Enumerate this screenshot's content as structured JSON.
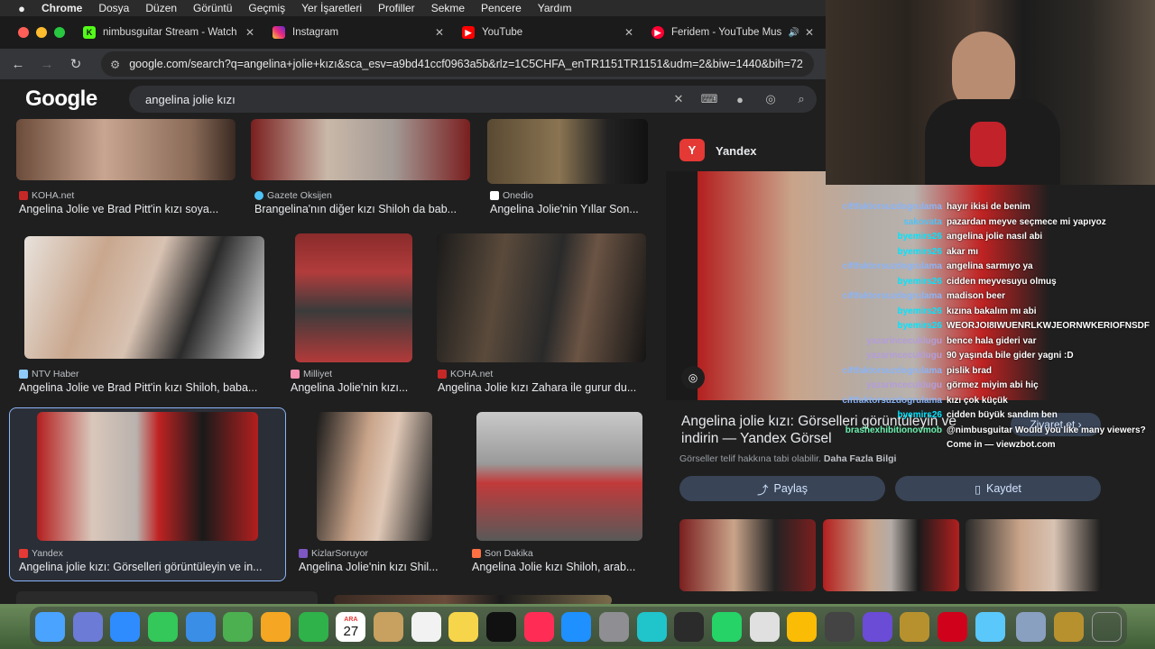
{
  "menubar": {
    "apple": "",
    "app": "Chrome",
    "items": [
      "Dosya",
      "Düzen",
      "Görüntü",
      "Geçmiş",
      "Yer İşaretleri",
      "Profiller",
      "Sekme",
      "Pencere",
      "Yardım"
    ]
  },
  "tabs": [
    {
      "title": "nimbusguitar Stream - Watch",
      "icon": "K",
      "color": "#53fc18"
    },
    {
      "title": "Instagram",
      "icon": "",
      "color": "#d6249f"
    },
    {
      "title": "YouTube",
      "icon": "▶",
      "color": "#ff0000"
    },
    {
      "title": "Feridem - YouTube Music",
      "icon": "▶",
      "color": "#ff0033"
    }
  ],
  "address": {
    "url": "google.com/search?q=angelina+jolie+kızı&sca_esv=a9bd41ccf0963a5b&rlz=1C5CHFA_enTR1151TR1151&udm=2&biw=1440&bih=72"
  },
  "google": {
    "logo": "Google",
    "query": "angelina jolie kızı"
  },
  "results": [
    {
      "source": "KOHA.net",
      "caption": "Angelina Jolie ve Brad Pitt'in kızı soya...",
      "src_color": "#c62828"
    },
    {
      "source": "Gazete Oksijen",
      "caption": "Brangelina'nın diğer kızı Shiloh da bab...",
      "src_color": "#4fc3f7"
    },
    {
      "source": "Onedio",
      "caption": "Angelina Jolie'nin Yıllar Son...",
      "src_color": "#ffffff"
    },
    {
      "source": "NTV Haber",
      "caption": "Angelina Jolie ve Brad Pitt'in kızı Shiloh, baba...",
      "src_color": "#90caf9"
    },
    {
      "source": "Milliyet",
      "caption": "Angelina Jolie'nin kızı...",
      "src_color": "#f48fb1"
    },
    {
      "source": "KOHA.net",
      "caption": "Angelina Jolie kızı Zahara ile gurur du...",
      "src_color": "#c62828"
    },
    {
      "source": "Yandex",
      "caption": "Angelina jolie kızı: Görselleri görüntüleyin ve in...",
      "src_color": "#e53935"
    },
    {
      "source": "KizlarSoruyor",
      "caption": "Angelina Jolie'nin kızı Shil...",
      "src_color": "#7e57c2"
    },
    {
      "source": "Son Dakika",
      "caption": "Angelina Jolie kızı Shiloh, arab...",
      "src_color": "#ff7043"
    }
  ],
  "panel": {
    "source": "Yandex",
    "title": "Angelina jolie kızı: Görselleri görüntüleyin ve indirin — Yandex Görsel",
    "note": "Görseller telif hakkına tabi olabilir.",
    "more": "Daha Fazla Bilgi",
    "visit": "Ziyaret et",
    "share": "Paylaş",
    "save": "Kaydet"
  },
  "chat": [
    {
      "user": "ciftfaktorsuzdogrulama",
      "text": "hayır ikisi de benim",
      "color": "#8ab4f8"
    },
    {
      "user": "sakovata",
      "text": "pazardan meyve seçmece mi yapıyoz",
      "color": "#4fc3f7"
    },
    {
      "user": "byemirs26",
      "text": "angelina jolie nasıl abi",
      "color": "#00e5ff"
    },
    {
      "user": "byemirs26",
      "text": "akar mı",
      "color": "#00e5ff"
    },
    {
      "user": "ciftfaktorsuzdogrulama",
      "text": "angelina sarmıyo ya",
      "color": "#8ab4f8"
    },
    {
      "user": "byemirs26",
      "text": "cidden meyvesuyu olmuş",
      "color": "#00e5ff"
    },
    {
      "user": "ciftfaktorsuzdogrulama",
      "text": "madison beer",
      "color": "#8ab4f8"
    },
    {
      "user": "byemirs26",
      "text": "kızına bakalım mı abi",
      "color": "#00e5ff"
    },
    {
      "user": "byemirs26",
      "text": "WEORJOI8IWUENRLKWJEORNWKERIOFNSDF",
      "color": "#00e5ff"
    },
    {
      "user": "yazarincecuklugu",
      "text": "bence hala gideri var",
      "color": "#b39ddb"
    },
    {
      "user": "yazarincecuklugu",
      "text": "90 yaşında bile gider yagni :D",
      "color": "#b39ddb"
    },
    {
      "user": "ciftfaktorsuzdogrulama",
      "text": "pislik brad",
      "color": "#8ab4f8"
    },
    {
      "user": "yazarincecuklugu",
      "text": "görmez miyim abi hiç",
      "color": "#b39ddb"
    },
    {
      "user": "ciftfaktorsuzdogrulama",
      "text": "kızı çok küçük",
      "color": "#8ab4f8"
    },
    {
      "user": "byemirs26",
      "text": "cidden büyük sandım ben",
      "color": "#00e5ff"
    },
    {
      "user": "brashexhibitionovmob",
      "text": "@nimbusguitar Would you like many viewers?",
      "color": "#69f0ae"
    },
    {
      "user": "",
      "text": "Come in — viewzbot.com",
      "color": "#ffffff"
    }
  ],
  "dock": {
    "calendar_month": "ARA",
    "calendar_day": "27",
    "apps": [
      "Finder",
      "Launchpad",
      "Safari",
      "Messages",
      "Mail",
      "Maps",
      "Photos",
      "FaceTime",
      "Calendar",
      "Notes",
      "Reminders",
      "Stickies",
      "Apple TV",
      "Music",
      "App Store",
      "System Settings",
      "Canva",
      "OBS",
      "WhatsApp",
      "Steam",
      "Chrome",
      "Calculator",
      "iMovie",
      "League of Legends",
      "Riot Client",
      "QuickTime",
      "Preview",
      "League",
      "Trash"
    ]
  }
}
